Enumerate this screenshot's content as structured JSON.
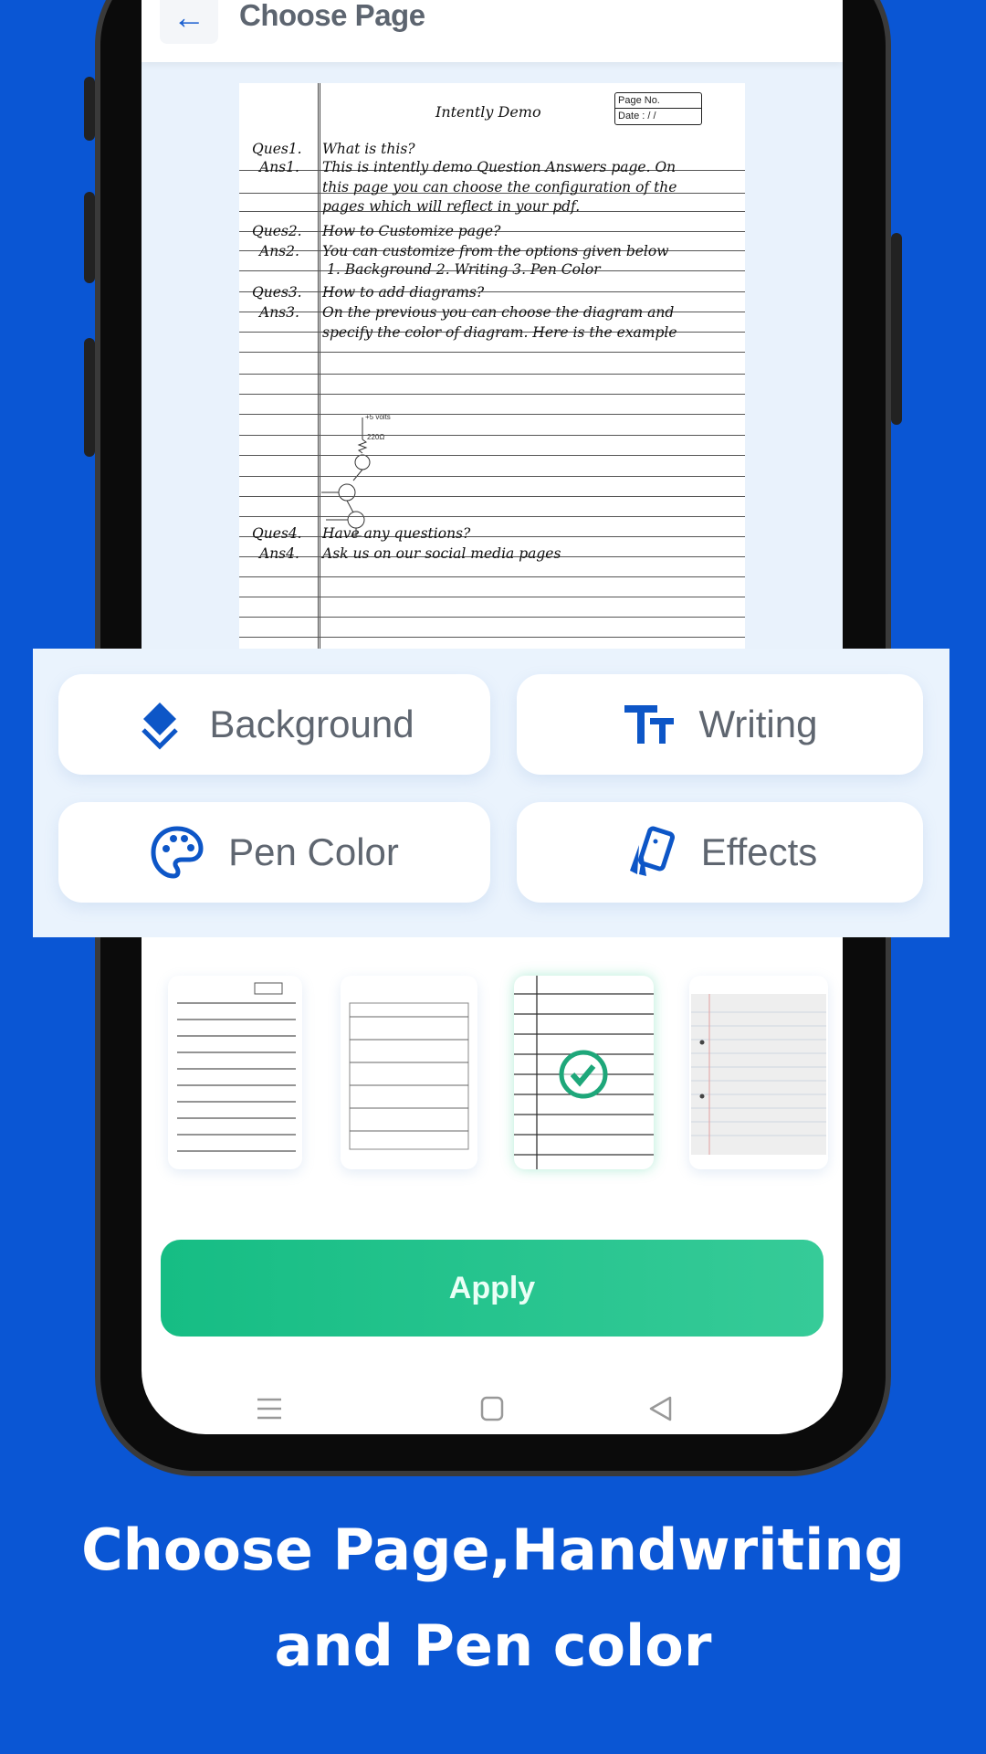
{
  "header": {
    "title": "Choose Page",
    "back_icon": "arrow-left-icon"
  },
  "preview": {
    "title": "Intently Demo",
    "page_no_label": "Page No.",
    "date_label": "Date :  /  /",
    "lines": [
      {
        "label": "Ques1.",
        "text": "What is this?"
      },
      {
        "label": "Ans1.",
        "text": "This is intently demo Question Answers page. On"
      },
      {
        "label": "",
        "text": "this page you can choose the configuration of the"
      },
      {
        "label": "",
        "text": "pages which will reflect in your pdf."
      },
      {
        "label": "Ques2.",
        "text": "How to Customize page?"
      },
      {
        "label": "Ans2.",
        "text": "You can customize from the options given below"
      },
      {
        "label": "",
        "text": "1. Background    2. Writing    3. Pen Color"
      },
      {
        "label": "Ques3.",
        "text": "How to add diagrams?"
      },
      {
        "label": "Ans3.",
        "text": "On the previous you can choose the diagram and"
      },
      {
        "label": "",
        "text": "specify the color of diagram. Here is the example"
      },
      {
        "label": "Ques4.",
        "text": "Have any questions?"
      },
      {
        "label": "Ans4.",
        "text": "Ask us on our social media pages"
      }
    ],
    "diagram": {
      "voltage_label": "+5 volts",
      "resistor_label": "220Ω"
    }
  },
  "options": [
    {
      "label": "Background",
      "icon": "layers-icon"
    },
    {
      "label": "Writing",
      "icon": "text-size-icon"
    },
    {
      "label": "Pen Color",
      "icon": "palette-icon"
    },
    {
      "label": "Effects",
      "icon": "cards-icon"
    }
  ],
  "thumbnails": {
    "selected_index": 2,
    "count": 4
  },
  "apply_label": "Apply",
  "colors": {
    "brand_blue": "#0a56d4",
    "accent_green": "#1cc08a",
    "text_gray": "#5f6670"
  },
  "caption": {
    "line1": "Choose Page,Handwriting",
    "line2": "and Pen color"
  }
}
